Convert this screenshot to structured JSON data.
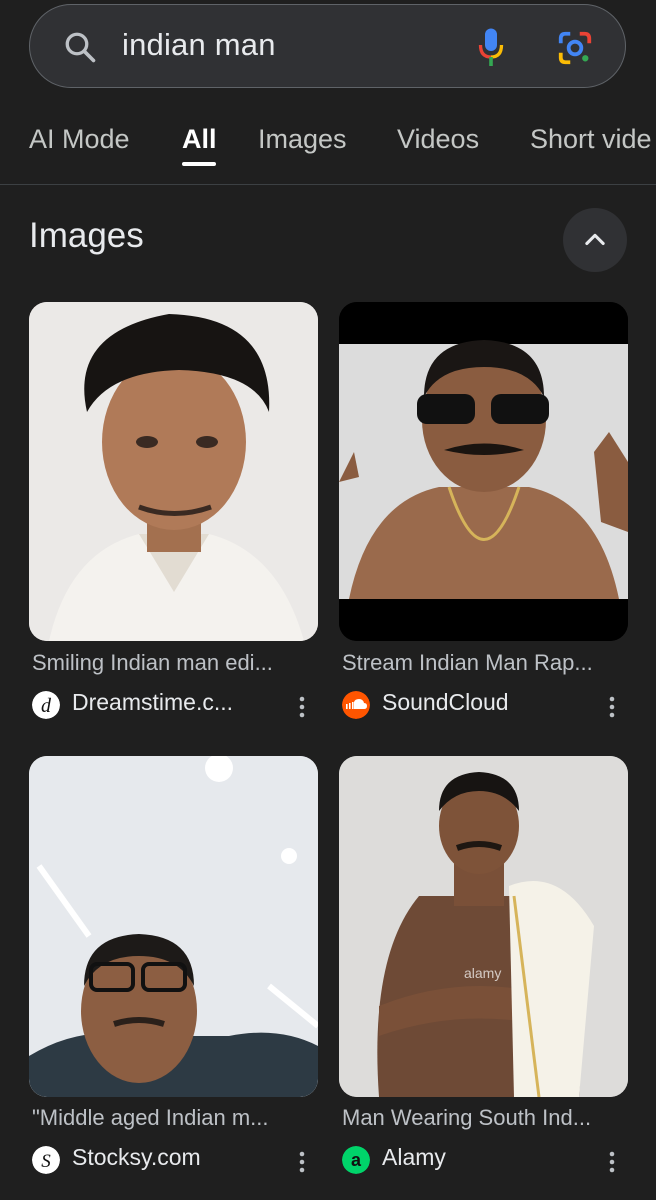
{
  "search": {
    "query": "indian man",
    "icon": "search-icon",
    "voice_icon": "microphone-icon",
    "lens_icon": "google-lens-icon"
  },
  "tabs": [
    {
      "label": "AI Mode",
      "active": false
    },
    {
      "label": "All",
      "active": true
    },
    {
      "label": "Images",
      "active": false
    },
    {
      "label": "Videos",
      "active": false
    },
    {
      "label": "Short vide",
      "active": false
    }
  ],
  "images_section": {
    "title": "Images",
    "collapse_icon": "chevron-up-icon",
    "results": [
      {
        "title": "Smiling Indian man edi...",
        "source": "Dreamstime.c...",
        "source_icon": "dreamstime-logo"
      },
      {
        "title": "Stream Indian Man Rap...",
        "source": "SoundCloud",
        "source_icon": "soundcloud-logo"
      },
      {
        "title": "\"Middle aged Indian m...",
        "source": "Stocksy.com",
        "source_icon": "stocksy-logo"
      },
      {
        "title": "Man Wearing South Ind...",
        "source": "Alamy",
        "source_icon": "alamy-logo"
      }
    ]
  },
  "colors": {
    "background": "#1f1f1f",
    "search_bg": "#303134",
    "text_primary": "#e8eaed",
    "text_secondary": "#bdc1c6",
    "soundcloud": "#ff5500",
    "alamy": "#00d46a"
  }
}
